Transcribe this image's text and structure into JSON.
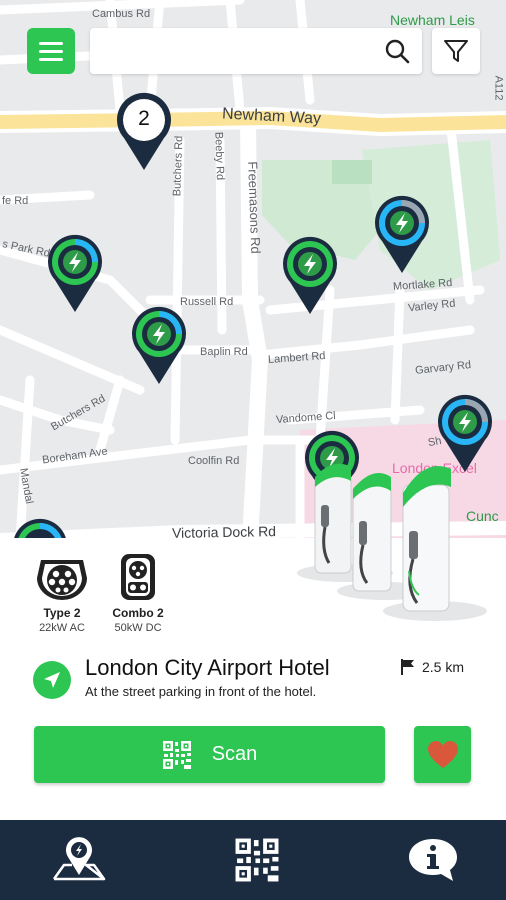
{
  "map": {
    "streets": [
      {
        "name": "Cambus Rd",
        "cls": ""
      },
      {
        "name": "Newham Leis",
        "cls": "green"
      },
      {
        "name": "A112",
        "cls": ""
      },
      {
        "name": "Newham Way",
        "cls": "big"
      },
      {
        "name": "Butchers Rd",
        "cls": ""
      },
      {
        "name": "Beeby Rd",
        "cls": ""
      },
      {
        "name": "Freemasons Rd",
        "cls": ""
      },
      {
        "name": "fe Rd",
        "cls": ""
      },
      {
        "name": "s Park Rd",
        "cls": ""
      },
      {
        "name": "Russell Rd",
        "cls": ""
      },
      {
        "name": "Mortlake Rd",
        "cls": ""
      },
      {
        "name": "Varley Rd",
        "cls": ""
      },
      {
        "name": "Baplin Rd",
        "cls": ""
      },
      {
        "name": "Lambert Rd",
        "cls": ""
      },
      {
        "name": "Garvary Rd",
        "cls": ""
      },
      {
        "name": "Butchers Rd",
        "cls": ""
      },
      {
        "name": "Vandome Cl",
        "cls": ""
      },
      {
        "name": "Boreham Ave",
        "cls": ""
      },
      {
        "name": "Coolfin Rd",
        "cls": ""
      },
      {
        "name": "Mandal",
        "cls": ""
      },
      {
        "name": "Victoria Dock Rd",
        "cls": "big"
      },
      {
        "name": "London Excel",
        "cls": "pink"
      },
      {
        "name": "Cunc",
        "cls": "green"
      },
      {
        "name": "Sh",
        "cls": ""
      }
    ],
    "cluster_count": "2",
    "search": {
      "value": "",
      "placeholder": ""
    },
    "colors": {
      "accent": "#2dc653",
      "pin": "#1b2b40",
      "ring": "#29b6f6"
    }
  },
  "connectors": [
    {
      "icon": "type2-plug-icon",
      "name": "Type 2",
      "spec": "22kW AC"
    },
    {
      "icon": "combo2-plug-icon",
      "name": "Combo 2",
      "spec": "50kW DC"
    }
  ],
  "station": {
    "name": "London City Airport Hotel",
    "description": "At the street parking in front of the hotel.",
    "distance": "2.5 km"
  },
  "actions": {
    "scan_label": "Scan"
  },
  "bottom_nav": [
    {
      "icon": "map-pin-icon",
      "label": "Map"
    },
    {
      "icon": "qr-code-icon",
      "label": "Scan QR"
    },
    {
      "icon": "info-icon",
      "label": "Info"
    }
  ]
}
